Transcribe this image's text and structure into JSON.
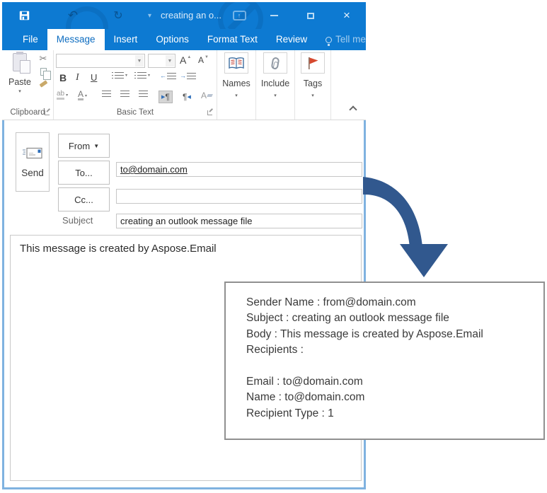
{
  "window": {
    "title": "creating an o...",
    "tabs": [
      {
        "label": "File"
      },
      {
        "label": "Message"
      },
      {
        "label": "Insert"
      },
      {
        "label": "Options"
      },
      {
        "label": "Format Text"
      },
      {
        "label": "Review"
      },
      {
        "label": "Tell me..."
      }
    ],
    "ribbon": {
      "paste_label": "Paste",
      "clipboard_group": "Clipboard",
      "basic_text_group": "Basic Text",
      "bold": "B",
      "italic": "I",
      "underline": "U",
      "highlight": "ab",
      "font_color": "A",
      "grow_font": "A",
      "shrink_font": "A",
      "clear_formatting": "A",
      "ltr_paragraph": "¶",
      "rtl_paragraph": "¶",
      "names_label": "Names",
      "include_label": "Include",
      "tags_label": "Tags"
    },
    "compose": {
      "send": "Send",
      "from": "From",
      "to": "To...",
      "cc": "Cc...",
      "subject_label": "Subject",
      "to_value": "to@domain.com",
      "cc_value": "",
      "subject_value": "creating an outlook message file",
      "body": "This message is created by Aspose.Email"
    }
  },
  "output_box": {
    "lines": [
      "Sender Name : from@domain.com",
      "Subject : creating an outlook message file",
      "Body : This message is created by Aspose.Email",
      "Recipients :",
      "",
      "Email : to@domain.com",
      "Name : to@domain.com",
      "Recipient Type : 1"
    ]
  },
  "colors": {
    "titlebar_blue": "#0d7ad2",
    "tab_selected_text": "#0c6cc0",
    "window_border": "#7fb2e0",
    "arrow_blue": "#31588e",
    "flag_red": "#d6492f",
    "output_border": "#909090"
  }
}
